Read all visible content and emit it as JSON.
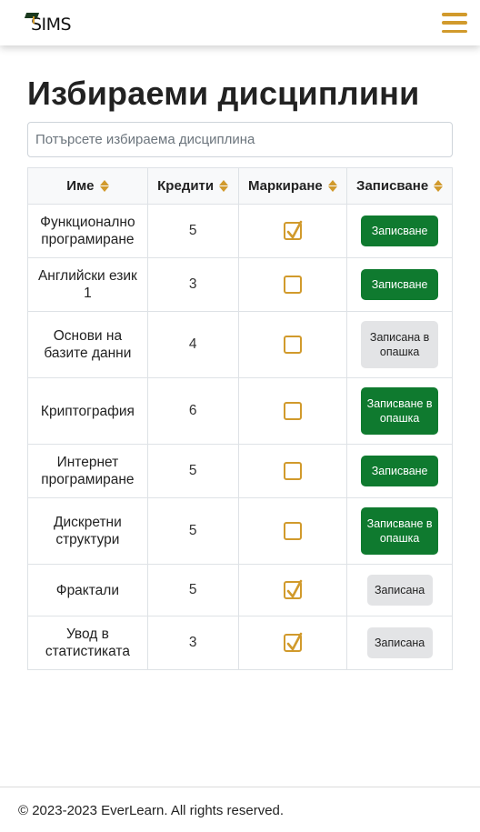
{
  "brand": {
    "logo_text": "SIMS",
    "accent_color": "#d19a2c",
    "primary_color": "#0f7a2f"
  },
  "header": {
    "menu_icon": "hamburger-menu-icon"
  },
  "page": {
    "title": "Избираеми дисциплини"
  },
  "search": {
    "placeholder": "Потърсете избираема дисциплина"
  },
  "table": {
    "columns": [
      "Име",
      "Кредити",
      "Маркиране",
      "Записване"
    ],
    "rows": [
      {
        "name": "Функционално програмиране",
        "credits": "5",
        "marked": true,
        "action": "Записване"
      },
      {
        "name": "Английски език 1",
        "credits": "3",
        "marked": false,
        "action": "Записване"
      },
      {
        "name": "Основи на базите данни",
        "credits": "4",
        "marked": false,
        "action": "Записана в опашка"
      },
      {
        "name": "Криптография",
        "credits": "6",
        "marked": false,
        "action": "Записване в опашка"
      },
      {
        "name": "Интернет програмиране",
        "credits": "5",
        "marked": false,
        "action": "Записване"
      },
      {
        "name": "Дискретни структури",
        "credits": "5",
        "marked": false,
        "action": "Записване в опашка"
      },
      {
        "name": "Фрактали",
        "credits": "5",
        "marked": true,
        "action": "Записана"
      },
      {
        "name": "Увод в статистиката",
        "credits": "3",
        "marked": true,
        "action": "Записана"
      }
    ]
  },
  "footer": {
    "text": "© 2023-2023 EverLearn. All rights reserved."
  }
}
